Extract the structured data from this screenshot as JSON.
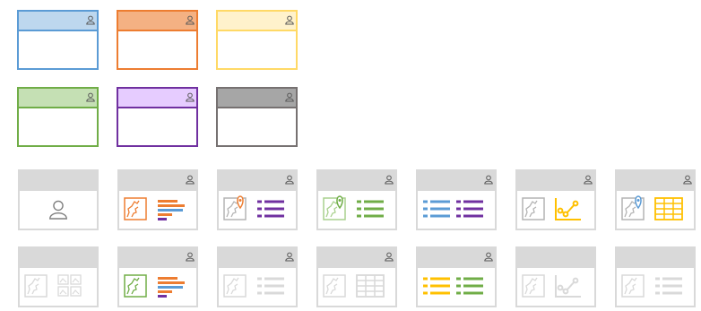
{
  "colors": {
    "blue": {
      "border": "#5b9bd5",
      "fill": "#bdd7ee"
    },
    "orange": {
      "border": "#ed7d31",
      "fill": "#f4b183"
    },
    "yellow": {
      "border": "#ffd966",
      "fill": "#fff2cc"
    },
    "green": {
      "border": "#70ad47",
      "fill": "#c5e0b4"
    },
    "purple": {
      "border": "#7030a0",
      "fill": "#e6ccff"
    },
    "gray": {
      "border": "#767171",
      "fill": "#a6a6a6"
    },
    "light": {
      "border": "#d9d9d9",
      "fill": "#d9d9d9"
    },
    "mapline": "#b4b4b4",
    "list_orange": "#ed7d31",
    "list_blue": "#5b9bd5",
    "list_purple": "#7030a0",
    "list_green": "#70ad47",
    "list_yellow": "#ffc000",
    "pale_line": "#d9d9d9"
  },
  "color_swatches": [
    {
      "name": "blue-swatch",
      "theme": "blue"
    },
    {
      "name": "orange-swatch",
      "theme": "orange"
    },
    {
      "name": "yellow-swatch",
      "theme": "yellow"
    },
    {
      "name": "green-swatch",
      "theme": "green"
    },
    {
      "name": "purple-swatch",
      "theme": "purple"
    },
    {
      "name": "gray-swatch",
      "theme": "gray"
    }
  ],
  "layout_templates": [
    {
      "name": "template-user-only",
      "person": false,
      "content": [
        "person"
      ]
    },
    {
      "name": "template-map-orange-bars",
      "person": true,
      "content": [
        "map-orange",
        "bars-multi"
      ]
    },
    {
      "name": "template-map-orange-pin-purple-list",
      "person": true,
      "content": [
        "map-gray-pin-orange",
        "list-purple"
      ]
    },
    {
      "name": "template-map-green-pin-green-list",
      "person": true,
      "content": [
        "map-green-pin-green",
        "list-green"
      ]
    },
    {
      "name": "template-blue-purple-lists",
      "person": true,
      "content": [
        "list-blue",
        "list-purple"
      ]
    },
    {
      "name": "template-map-yellow-chart",
      "person": true,
      "content": [
        "map-gray",
        "chart-yellow"
      ]
    },
    {
      "name": "template-map-blue-pin-yellow-table",
      "person": true,
      "content": [
        "map-gray-pin-blue",
        "table-yellow"
      ]
    },
    {
      "name": "template-map-photo-grid",
      "person": false,
      "content": [
        "map-pale",
        "photo-grid"
      ]
    },
    {
      "name": "template-map-green-bars",
      "person": true,
      "content": [
        "map-green",
        "bars-multi"
      ]
    },
    {
      "name": "template-map-pale-list",
      "person": true,
      "content": [
        "map-pale",
        "list-pale"
      ]
    },
    {
      "name": "template-map-pale-table",
      "person": true,
      "content": [
        "map-pale",
        "table-pale"
      ]
    },
    {
      "name": "template-yellow-green-lists",
      "person": true,
      "content": [
        "list-yellow",
        "list-green"
      ]
    },
    {
      "name": "template-map-pale-chart",
      "person": false,
      "content": [
        "map-pale",
        "chart-pale"
      ]
    },
    {
      "name": "template-map-pale-list-2",
      "person": false,
      "content": [
        "map-pale",
        "list-pale"
      ]
    }
  ]
}
